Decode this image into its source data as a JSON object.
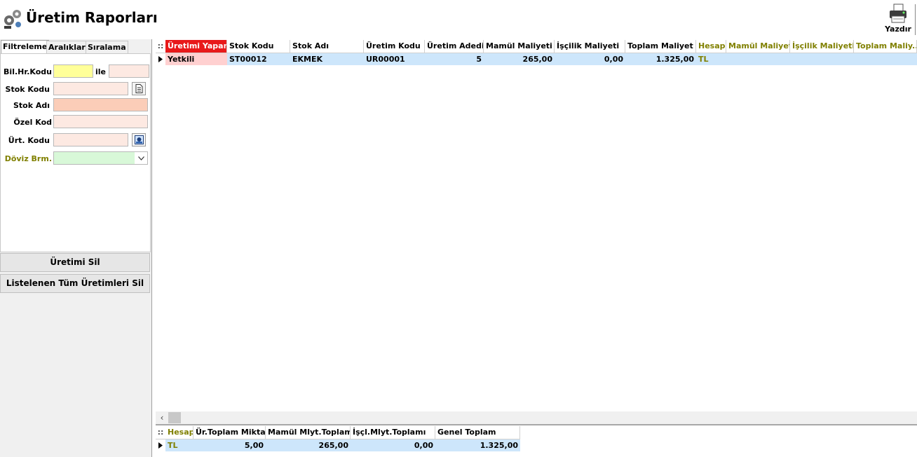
{
  "window": {
    "title": "Üretim Raporları",
    "print_label": "Yazdır"
  },
  "left_panel": {
    "tabs": [
      {
        "label": "Filtreleme"
      },
      {
        "label": "Aralıklar"
      },
      {
        "label": "Sıralama"
      }
    ],
    "filters": {
      "bil_hr_kodu_label": "Bil.Hr.Kodu",
      "ile_label": "ile",
      "stok_kodu_label": "Stok Kodu",
      "stok_adi_label": "Stok Adı",
      "ozel_kod_label": "Özel Kod",
      "urt_kodu_label": "Ürt. Kodu",
      "doviz_brm_label": "Döviz Brm.",
      "bil_hr_kodu_value": "",
      "bil_hr_kodu_to_value": "",
      "stok_kodu_value": "",
      "stok_adi_value": "",
      "ozel_kod_value": "",
      "urt_kodu_value": "",
      "doviz_brm_value": ""
    },
    "buttons": {
      "delete_production": "Üretimi Sil",
      "delete_all_listed": "Listelenen Tüm Üretimleri Sil"
    }
  },
  "main_grid": {
    "header_indicator": "::",
    "columns": [
      "Üretimi Yapan",
      "Stok Kodu",
      "Stok Adı",
      "Üretim Kodu",
      "Üretim Adedi",
      "Mamül Maliyeti",
      "İşçilik Maliyeti",
      "Toplam Maliyet",
      "Hesap",
      "Mamül Maliyeti",
      "İşçilik Maliyeti",
      "Toplam Maliy..."
    ],
    "rows": [
      [
        "Yetkili",
        "ST00012",
        "EKMEK",
        "UR00001",
        "5",
        "265,00",
        "0,00",
        "1.325,00",
        "TL",
        "",
        "",
        ""
      ]
    ]
  },
  "summary_grid": {
    "header_indicator": "::",
    "columns": [
      "Hesap",
      "Ür.Toplam Miktar",
      "Mamül Mlyt.Toplamı",
      "İşçl.Mlyt.Toplamı",
      "Genel Toplam"
    ],
    "rows": [
      [
        "TL",
        "5,00",
        "265,00",
        "0,00",
        "1.325,00"
      ]
    ]
  },
  "colors": {
    "highlight_header_red": "#e8191a",
    "olive_text": "#808000",
    "selected_row": "#cde6fb",
    "yetkili_cell": "#ffd0d0",
    "field_yellow": "#ffff99",
    "field_pink": "#fde9e2",
    "field_salmon": "#fbcdb8",
    "field_green": "#d8f8d8"
  }
}
